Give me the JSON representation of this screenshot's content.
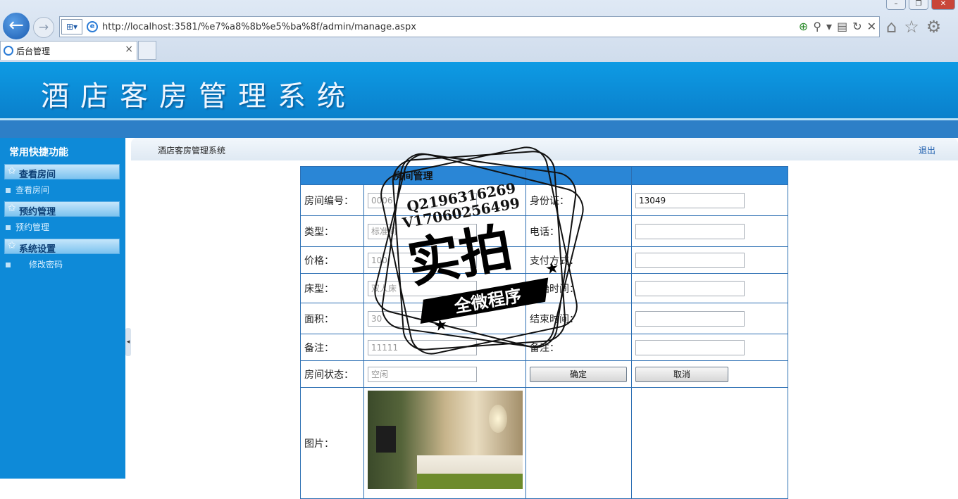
{
  "browser": {
    "url": "http://localhost:3581/%e7%a8%8b%e5%ba%8f/admin/manage.aspx",
    "tab_title": "后台管理",
    "tab_close": "×",
    "win_minimize": "–",
    "win_restore": "❐",
    "win_close": "✕"
  },
  "banner": {
    "title": "酒店客房管理系统"
  },
  "sidebar": {
    "title": "常用快捷功能",
    "groups": [
      {
        "header": "查看房间",
        "item": "查看房间"
      },
      {
        "header": "预约管理",
        "item": "预约管理"
      },
      {
        "header": "系统设置",
        "item": "修改密码"
      }
    ]
  },
  "content": {
    "system_name": "酒店客房管理系统",
    "logout": "退出",
    "table_title": "房间管理",
    "rows": [
      {
        "label": "房间编号：",
        "value": "0006",
        "label2": "身份证：",
        "value2": "13049"
      },
      {
        "label": "类型：",
        "value": "标准间",
        "label2": "电话：",
        "value2": ""
      },
      {
        "label": "价格：",
        "value": "100",
        "label2": "支付方式：",
        "value2": ""
      },
      {
        "label": "床型：",
        "value": "双人床",
        "label2": "开始时间：",
        "value2": ""
      },
      {
        "label": "面积：",
        "value": "30",
        "label2": "结束时间：",
        "value2": ""
      },
      {
        "label": "备注：",
        "value": "11111",
        "label2": "备注：",
        "value2": ""
      }
    ],
    "status_label": "房间状态：",
    "status_value": "空闲",
    "confirm": "确定",
    "cancel": "取消",
    "image_label": "图片："
  },
  "watermark": {
    "line1": "Q2196316269",
    "line2": "V17060256499",
    "main": "实拍",
    "ribbon": "全微程序"
  }
}
